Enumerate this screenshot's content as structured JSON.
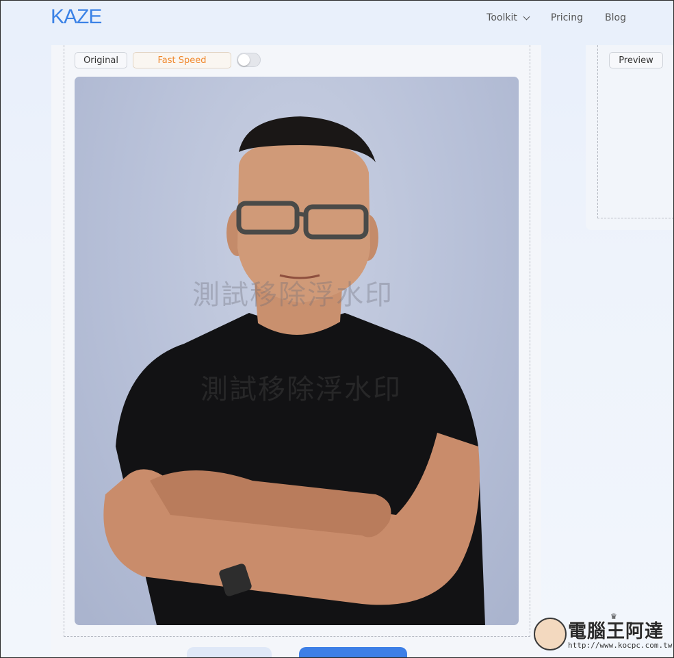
{
  "header": {
    "logo": "KAZE",
    "nav": [
      {
        "label": "Toolkit",
        "has_dropdown": true
      },
      {
        "label": "Pricing"
      },
      {
        "label": "Blog"
      }
    ]
  },
  "editor": {
    "original_label": "Original",
    "mode_label": "Fast Speed",
    "toggle_on": false,
    "preview_label": "Preview",
    "watermark_text_1": "測試移除浮水印",
    "watermark_text_2": "測試移除浮水印"
  },
  "badge": {
    "title": "電腦王阿達",
    "url": "http://www.kocpc.com.tw"
  },
  "colors": {
    "accent": "#3b82e6",
    "fast_speed": "#f0872b",
    "primary_button": "#3d7fe6"
  }
}
